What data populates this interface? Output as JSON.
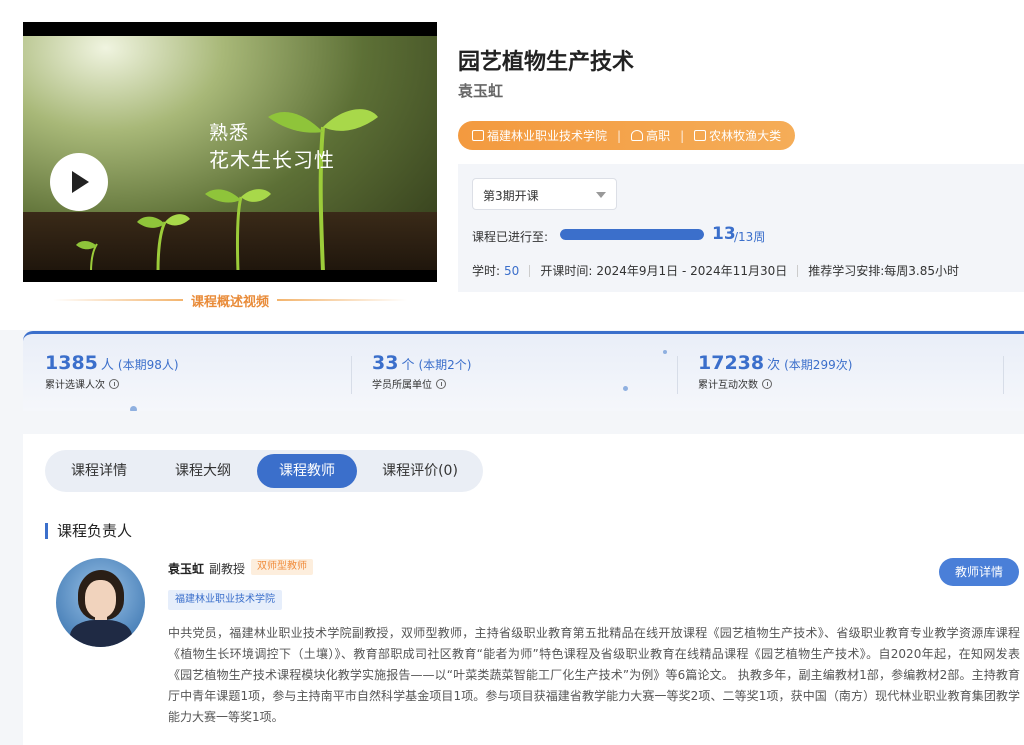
{
  "video": {
    "caption_line1": "熟悉",
    "caption_line2": "花木生长习性",
    "label": "课程概述视频"
  },
  "course": {
    "title": "园艺植物生产技术",
    "teacher": "袁玉虹",
    "tags": [
      "福建林业职业技术学院",
      "高职",
      "农林牧渔大类"
    ]
  },
  "term": {
    "selected": "第3期开课"
  },
  "progress": {
    "label": "课程已进行至:",
    "current": "13",
    "total": "/13周",
    "fraction": 1.0
  },
  "meta": {
    "hours_label": "学时:",
    "hours_value": "50",
    "period_label": "开课时间:",
    "period_value": "2024年9月1日 - 2024年11月30日",
    "schedule": "推荐学习安排:每周3.85小时"
  },
  "stats": [
    {
      "num": "1385",
      "unit": "人",
      "period": "(本期98人)",
      "label": "累计选课人次"
    },
    {
      "num": "33",
      "unit": "个",
      "period": "(本期2个)",
      "label": "学员所属单位"
    },
    {
      "num": "17238",
      "unit": "次",
      "period": "(本期299次)",
      "label": "累计互动次数"
    }
  ],
  "tabs": [
    {
      "label": "课程详情",
      "active": false
    },
    {
      "label": "课程大纲",
      "active": false
    },
    {
      "label": "课程教师",
      "active": true
    },
    {
      "label": "课程评价(0)",
      "active": false
    }
  ],
  "section": {
    "title": "课程负责人"
  },
  "instructor": {
    "name": "袁玉虹",
    "title": "副教授",
    "badge": "双师型教师",
    "school": "福建林业职业技术学院",
    "detail_button": "教师详情",
    "bio": "中共党员，福建林业职业技术学院副教授，双师型教师，主持省级职业教育第五批精品在线开放课程《园艺植物生产技术》、省级职业教育专业教学资源库课程《植物生长环境调控下（土壤）》、教育部职成司社区教育“能者为师”特色课程及省级职业教育在线精品课程《园艺植物生产技术》。自2020年起，在知网发表《园艺植物生产技术课程模块化教学实施报告——以“叶菜类蔬菜智能工厂化生产技术”为例》等6篇论文。 执教多年，副主编教材1部，参编教材2部。主持教育厅中青年课题1项，参与主持南平市自然科学基金项目1项。参与项目获福建省教学能力大赛一等奖2项、二等奖1项，获中国（南方）现代林业职业教育集团教学能力大赛一等奖1项。"
  },
  "colors": {
    "accent": "#3b6fcb",
    "orange": "#f39a3f"
  }
}
